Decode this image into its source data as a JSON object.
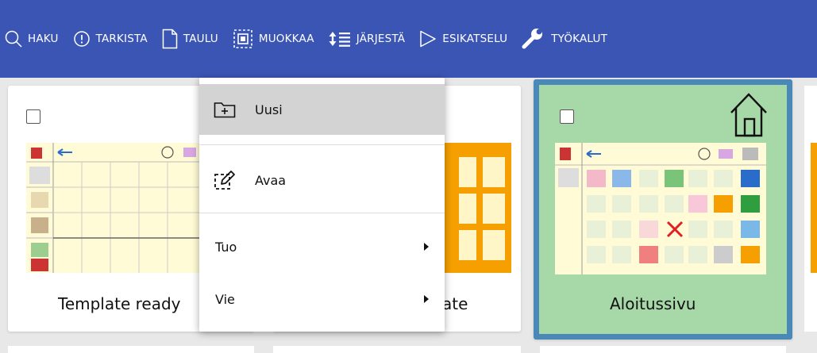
{
  "toolbar": {
    "items": [
      {
        "label": "HAKU",
        "icon": "search-icon"
      },
      {
        "label": "TARKISTA",
        "icon": "alert-circle-icon"
      },
      {
        "label": "TAULU",
        "icon": "file-icon"
      },
      {
        "label": "MUOKKAA",
        "icon": "edit-selection-icon"
      },
      {
        "label": "JÄRJESTÄ",
        "icon": "sort-icon"
      },
      {
        "label": "ESIKATSELU",
        "icon": "play-icon"
      },
      {
        "label": "TYÖKALUT",
        "icon": "wrench-icon"
      }
    ]
  },
  "tiles": [
    {
      "name": "Template ready",
      "selected": false
    },
    {
      "name": "ate",
      "selected": false,
      "accent": "#f5a000"
    },
    {
      "name": "Aloitussivu",
      "selected": true,
      "icon": "home-icon",
      "background": "#a6d8a8",
      "border": "#4a88b8"
    }
  ],
  "menu": {
    "items": [
      {
        "label": "Uusi",
        "icon": "new-folder-icon",
        "highlighted": true
      },
      {
        "label": "Avaa",
        "icon": "open-edit-icon"
      },
      {
        "label": "Tuo",
        "icon": "chevron-right-icon"
      },
      {
        "label": "Vie",
        "icon": "chevron-right-icon"
      }
    ]
  },
  "colors": {
    "toolbar": "#3b55b5",
    "highlight": "#d3d3d3",
    "accent": "#f5a000"
  }
}
